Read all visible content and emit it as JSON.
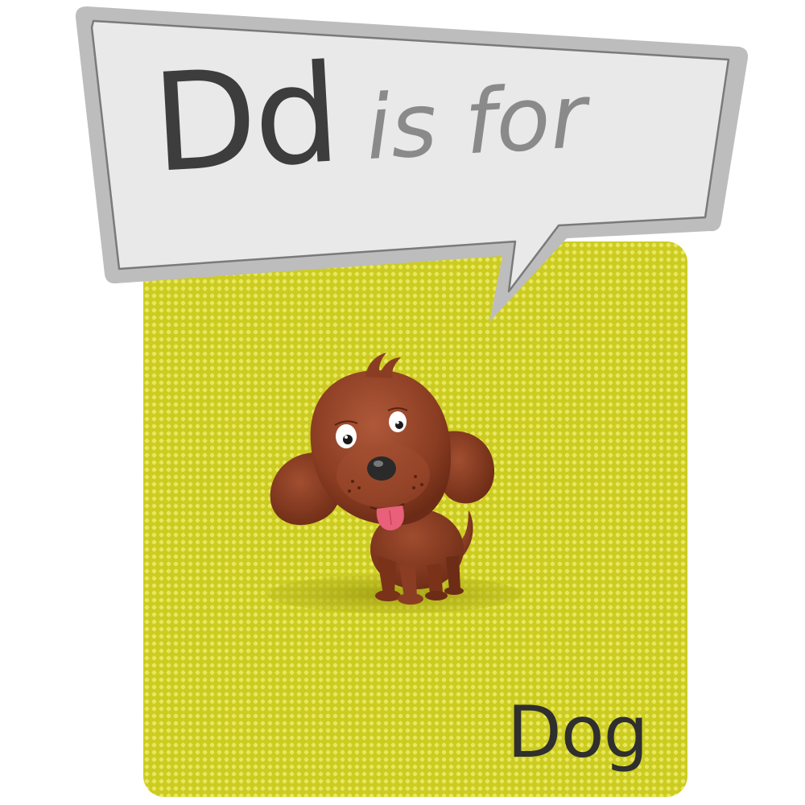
{
  "card": {
    "letters": "Dd",
    "connector": "is for",
    "word": "Dog"
  },
  "colors": {
    "card_background": "#d6d526",
    "bubble_fill": "#e9e9e9",
    "bubble_border": "#bdbdbd",
    "letters_color": "#3d3d3d",
    "connector_color": "#8a8a8a",
    "dog_brown": "#8a3d22",
    "dog_tongue": "#e8607a"
  },
  "icons": {
    "illustration": "dog-icon"
  }
}
